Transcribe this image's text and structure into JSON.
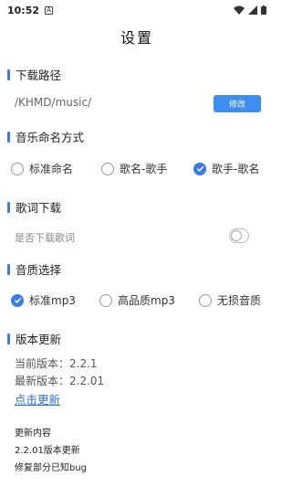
{
  "status_bar": {
    "time": "10:52",
    "notification_glyph": "A"
  },
  "header": {
    "title": "设置"
  },
  "download_path": {
    "section_title": "下载路径",
    "path": "/KHMD/music/",
    "edit_label": "修改"
  },
  "naming": {
    "section_title": "音乐命名方式",
    "options": [
      {
        "label": "标准命名",
        "checked": false
      },
      {
        "label": "歌名-歌手",
        "checked": false
      },
      {
        "label": "歌手-歌名",
        "checked": true
      }
    ]
  },
  "lyrics": {
    "section_title": "歌词下载",
    "label": "是否下载歌词",
    "enabled": false
  },
  "quality": {
    "section_title": "音质选择",
    "options": [
      {
        "label": "标准mp3",
        "checked": true
      },
      {
        "label": "高品质mp3",
        "checked": false
      },
      {
        "label": "无损音质",
        "checked": false
      }
    ]
  },
  "version": {
    "section_title": "版本更新",
    "current": "当前版本：2.2.1",
    "latest": "最新版本：2.2.01",
    "update_link": "点击更新",
    "notes_title": "更新内容",
    "notes_line1": "2.2.01版本更新",
    "notes_line2": "修复部分已知bug"
  },
  "colors": {
    "accent": "#3a7bea",
    "button": "#3d8ef0",
    "link": "#2f6fd6"
  }
}
